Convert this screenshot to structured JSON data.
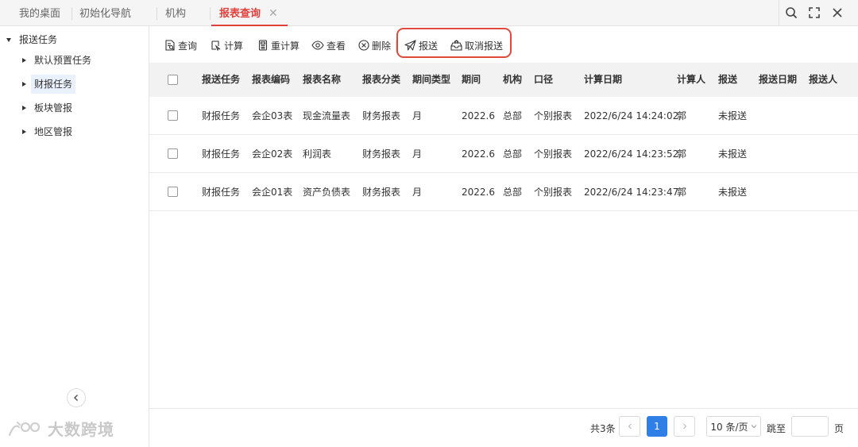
{
  "tabs": [
    {
      "label": "我的桌面",
      "active": false
    },
    {
      "label": "初始化导航",
      "active": false
    },
    {
      "label": "机构",
      "active": false
    },
    {
      "label": "报表查询",
      "active": true
    }
  ],
  "window_controls": [
    "search-icon",
    "fullscreen-icon",
    "close-icon"
  ],
  "sidebar": {
    "root": {
      "label": "报送任务",
      "expanded": true
    },
    "items": [
      {
        "label": "默认预置任务",
        "selected": false
      },
      {
        "label": "财报任务",
        "selected": true
      },
      {
        "label": "板块管报",
        "selected": false
      },
      {
        "label": "地区管报",
        "selected": false
      }
    ],
    "collapse_icon": "chevron-left-icon"
  },
  "toolbar": {
    "query": "查询",
    "calculate": "计算",
    "recalculate": "重计算",
    "view": "查看",
    "delete": "删除",
    "send": "报送",
    "cancel_send": "取消报送"
  },
  "table": {
    "columns": [
      "报送任务",
      "报表编码",
      "报表名称",
      "报表分类",
      "期间类型",
      "期间",
      "机构",
      "口径",
      "计算日期",
      "计算人",
      "报送",
      "报送日期",
      "报送人"
    ],
    "rows": [
      [
        "财报任务",
        "会企03表",
        "现金流量表",
        "财务报表",
        "月",
        "2022.6",
        "总部",
        "个别报表",
        "2022/6/24 14:24:02",
        "郭",
        "未报送",
        "",
        ""
      ],
      [
        "财报任务",
        "会企02表",
        "利润表",
        "财务报表",
        "月",
        "2022.6",
        "总部",
        "个别报表",
        "2022/6/24 14:23:52",
        "郭",
        "未报送",
        "",
        ""
      ],
      [
        "财报任务",
        "会企01表",
        "资产负债表",
        "财务报表",
        "月",
        "2022.6",
        "总部",
        "个别报表",
        "2022/6/24 14:23:47",
        "郭",
        "未报送",
        "",
        ""
      ]
    ]
  },
  "pagination": {
    "total": "共3条",
    "current_page": "1",
    "page_size": "10 条/页",
    "goto_label": "跳至",
    "goto_value": "",
    "page_suffix": "页"
  },
  "watermark": "大数跨境",
  "colors": {
    "accent": "#e0413c",
    "primary": "#2f7fe6",
    "highlight_box": "#e04a3d"
  }
}
